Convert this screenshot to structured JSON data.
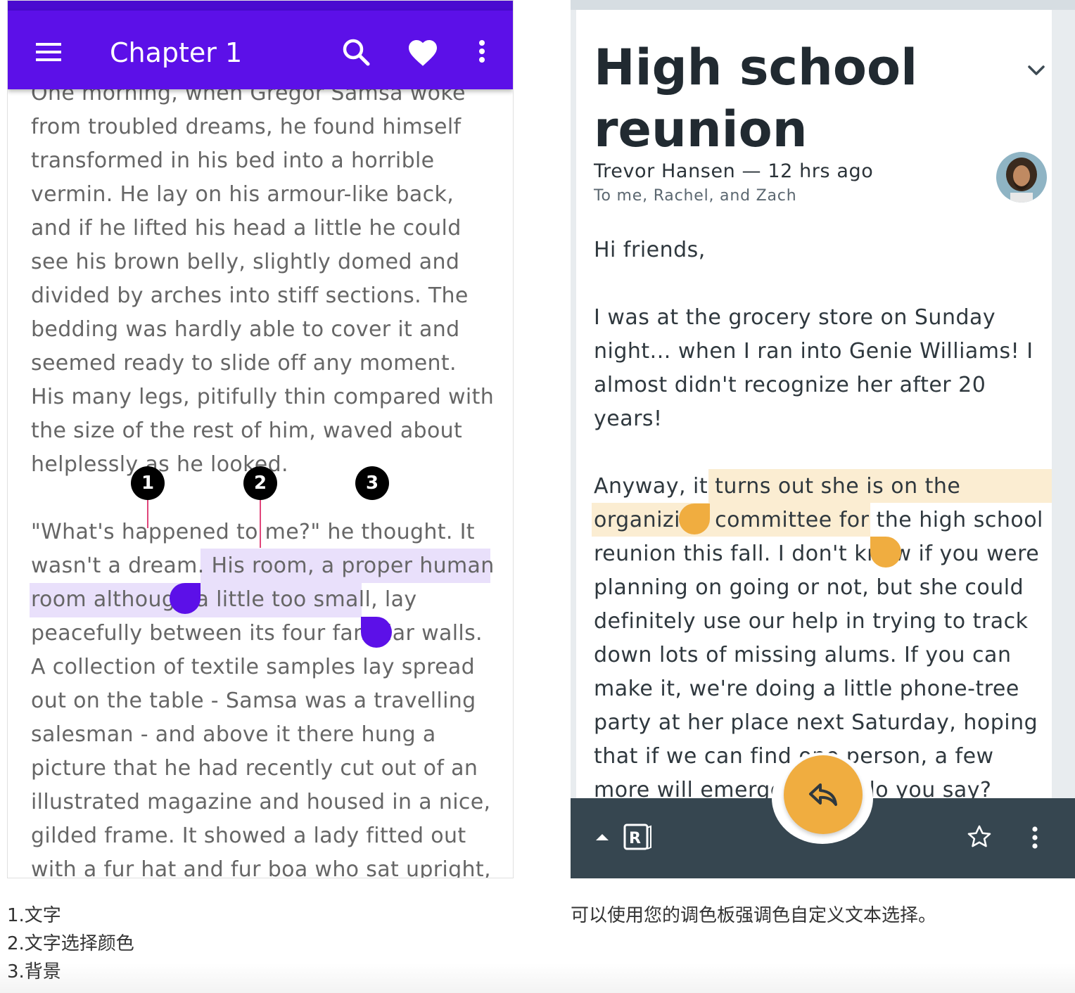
{
  "left": {
    "appbar": {
      "title": "Chapter 1",
      "icons": [
        "menu-icon",
        "search-icon",
        "heart-icon",
        "more-vert-icon"
      ],
      "color": "#5c10e8"
    },
    "paragraphs": [
      "One morning, when Gregor Samsa woke from troubled dreams, he found himself transformed in his bed into a horrible vermin. He lay on his armour-like back, and if he lifted his head a little he could see his brown belly, slightly domed and divided by arches into stiff sections. The bedding was hardly able to cover it and seemed ready to slide off any moment. His many legs, pitifully thin compared with the size of the rest of him, waved about helplessly as he looked.",
      "\"What's happened to me?\" he thought. It wasn't a dream. His room, a proper human room although a little too small, lay peacefully between its four familiar walls. A collection of textile samples lay spread out on the table - Samsa was a travelling salesman - and above it there hung a picture that he had recently cut out of an illustrated magazine and housed in a nice, gilded frame. It showed a lady fitted out with a fur hat and fur boa who sat upright,"
    ],
    "selection_color": "#e9e0fb",
    "handle_color": "#5c10e8",
    "markers": [
      "1",
      "2",
      "3"
    ]
  },
  "right": {
    "title": "High school reunion",
    "sender": "Trevor Hansen — 12 hrs ago",
    "recipients": "To me, Rachel, and Zach",
    "greeting": "Hi friends,",
    "paragraph1": "I was at the grocery store on Sunday night... when I ran into Genie Williams! I almost didn't recognize her after 20 years!",
    "paragraph2": "Anyway, it turns out she is on the organizing committee for the high school reunion this fall. I don't know if you were planning on going or not, but she could definitely use our help in trying to track down lots of missing alums. If you can make it, we're doing a little phone-tree party at her place next Saturday, hoping that if we can find one person, a few more will emerge. What do you say?",
    "selection_color": "#fbedd2",
    "handle_color": "#f0ad40",
    "bottom_bar_color": "#364650",
    "bottom_icons": [
      "expand-up-icon",
      "app-logo-icon",
      "reply-icon",
      "star-icon",
      "more-vert-icon"
    ]
  },
  "notes": {
    "left": [
      "1.文字",
      "2.文字选择颜色",
      "3.背景"
    ],
    "right": "可以使用您的调色板强调色自定义文本选择。"
  }
}
